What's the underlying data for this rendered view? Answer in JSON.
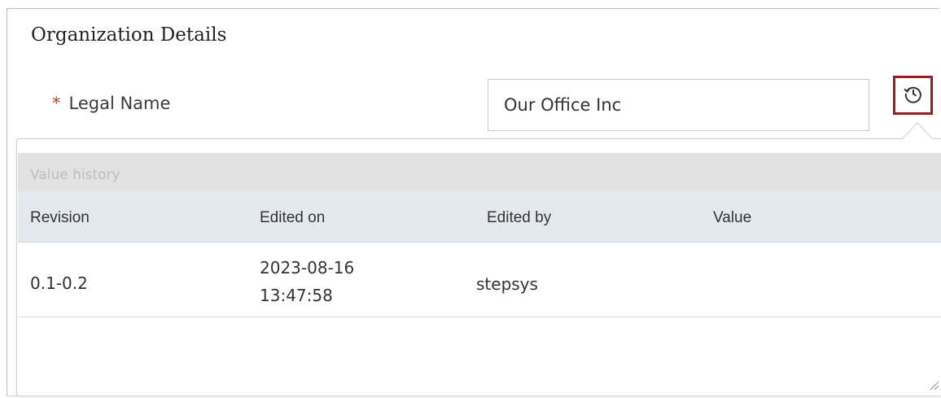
{
  "section": {
    "title": "Organization Details"
  },
  "field": {
    "required_mark": "*",
    "label": "Legal Name",
    "value": "Our Office Inc",
    "history_button_icon": "history-icon"
  },
  "history": {
    "title": "Value history",
    "columns": [
      "Revision",
      "Edited on",
      "Edited by",
      "Value"
    ],
    "rows": [
      {
        "revision": "0.1-0.2",
        "edited_on_date": "2023-08-16",
        "edited_on_time": "13:47:58",
        "edited_by": "stepsys",
        "value": ""
      }
    ]
  },
  "colors": {
    "accent_border": "#9b1b22",
    "required": "#c0392b",
    "header_bg": "#e4e9ed"
  }
}
